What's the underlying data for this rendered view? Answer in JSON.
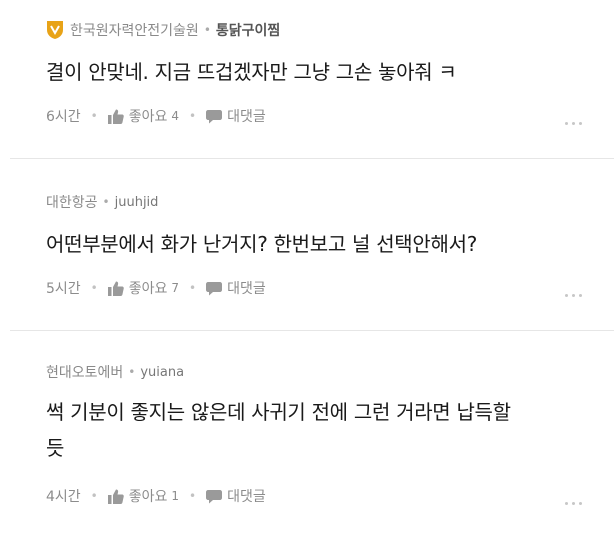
{
  "comments": [
    {
      "company": "한국원자력안전기술원",
      "nickname": "통닭구이찜",
      "has_badge": true,
      "text": "결이 안맞네. 지금 뜨겁겠자만 그냥 그손 놓아줘 ㅋ",
      "time": "6시간",
      "like_label": "좋아요",
      "like_count": "4",
      "reply_label": "대댓글"
    },
    {
      "company": "대한항공",
      "nickname": "juuhjid",
      "has_badge": false,
      "text": "어떤부분에서 화가 난거지? 한번보고 널 선택안해서?",
      "time": "5시간",
      "like_label": "좋아요",
      "like_count": "7",
      "reply_label": "대댓글"
    },
    {
      "company": "현대오토에버",
      "nickname": "yuiana",
      "has_badge": false,
      "text_line1": "썩 기분이 좋지는 않은데 사귀기 전에 그런 거라면 납득할",
      "text_line2": "듯",
      "time": "4시간",
      "like_label": "좋아요",
      "like_count": "1",
      "reply_label": "대댓글"
    }
  ],
  "colors": {
    "badge": "#e8a317",
    "meta_text": "#777777",
    "divider": "#e6e6e6"
  },
  "icons": [
    "badge-icon",
    "thumbs-up-icon",
    "speech-bubble-icon",
    "more-dots-icon"
  ]
}
